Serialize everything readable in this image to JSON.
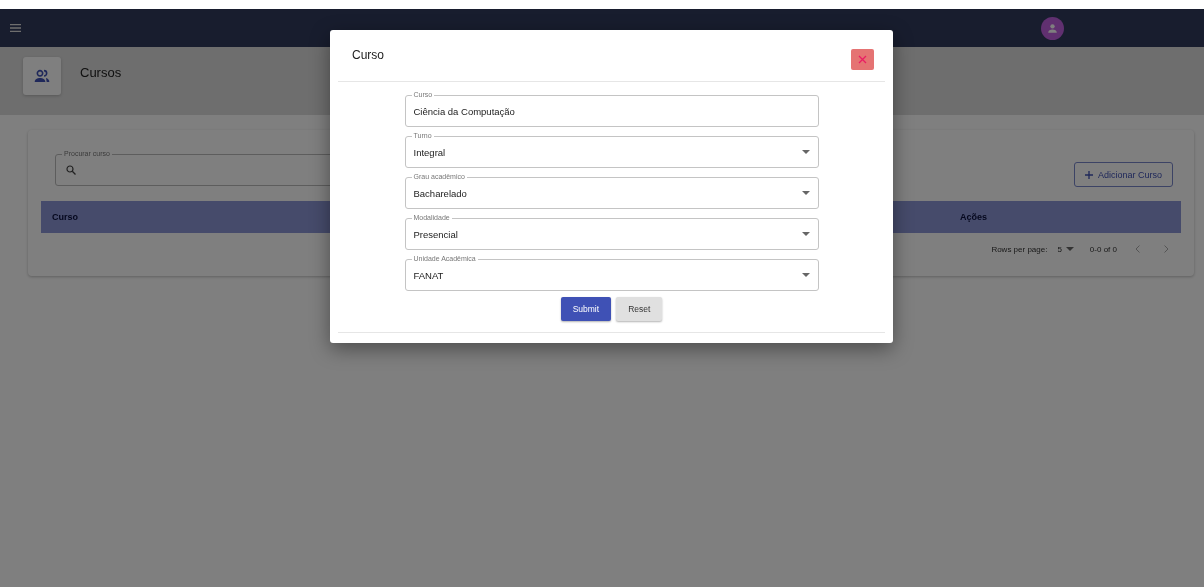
{
  "header": {
    "title": "Cursos"
  },
  "search": {
    "label": "Procurar curso"
  },
  "add_button": {
    "label": "Adicionar Curso"
  },
  "table": {
    "columns": [
      "Curso",
      "Ações"
    ]
  },
  "pagination": {
    "rows_label": "Rows per page:",
    "rows_value": "5",
    "range": "0-0 of 0"
  },
  "dialog": {
    "title": "Curso",
    "fields": [
      {
        "kind": "text",
        "label": "Curso",
        "value": "Ciência da Computação"
      },
      {
        "kind": "select",
        "label": "Turno",
        "value": "Integral"
      },
      {
        "kind": "select",
        "label": "Grau acadêmico",
        "value": "Bacharelado"
      },
      {
        "kind": "select",
        "label": "Modalidade",
        "value": "Presencial"
      },
      {
        "kind": "select",
        "label": "Unidade Acadêmica",
        "value": "FANAT"
      }
    ],
    "buttons": [
      {
        "kind": "primary",
        "label": "Submit"
      },
      {
        "kind": "secondary",
        "label": "Reset"
      }
    ]
  }
}
